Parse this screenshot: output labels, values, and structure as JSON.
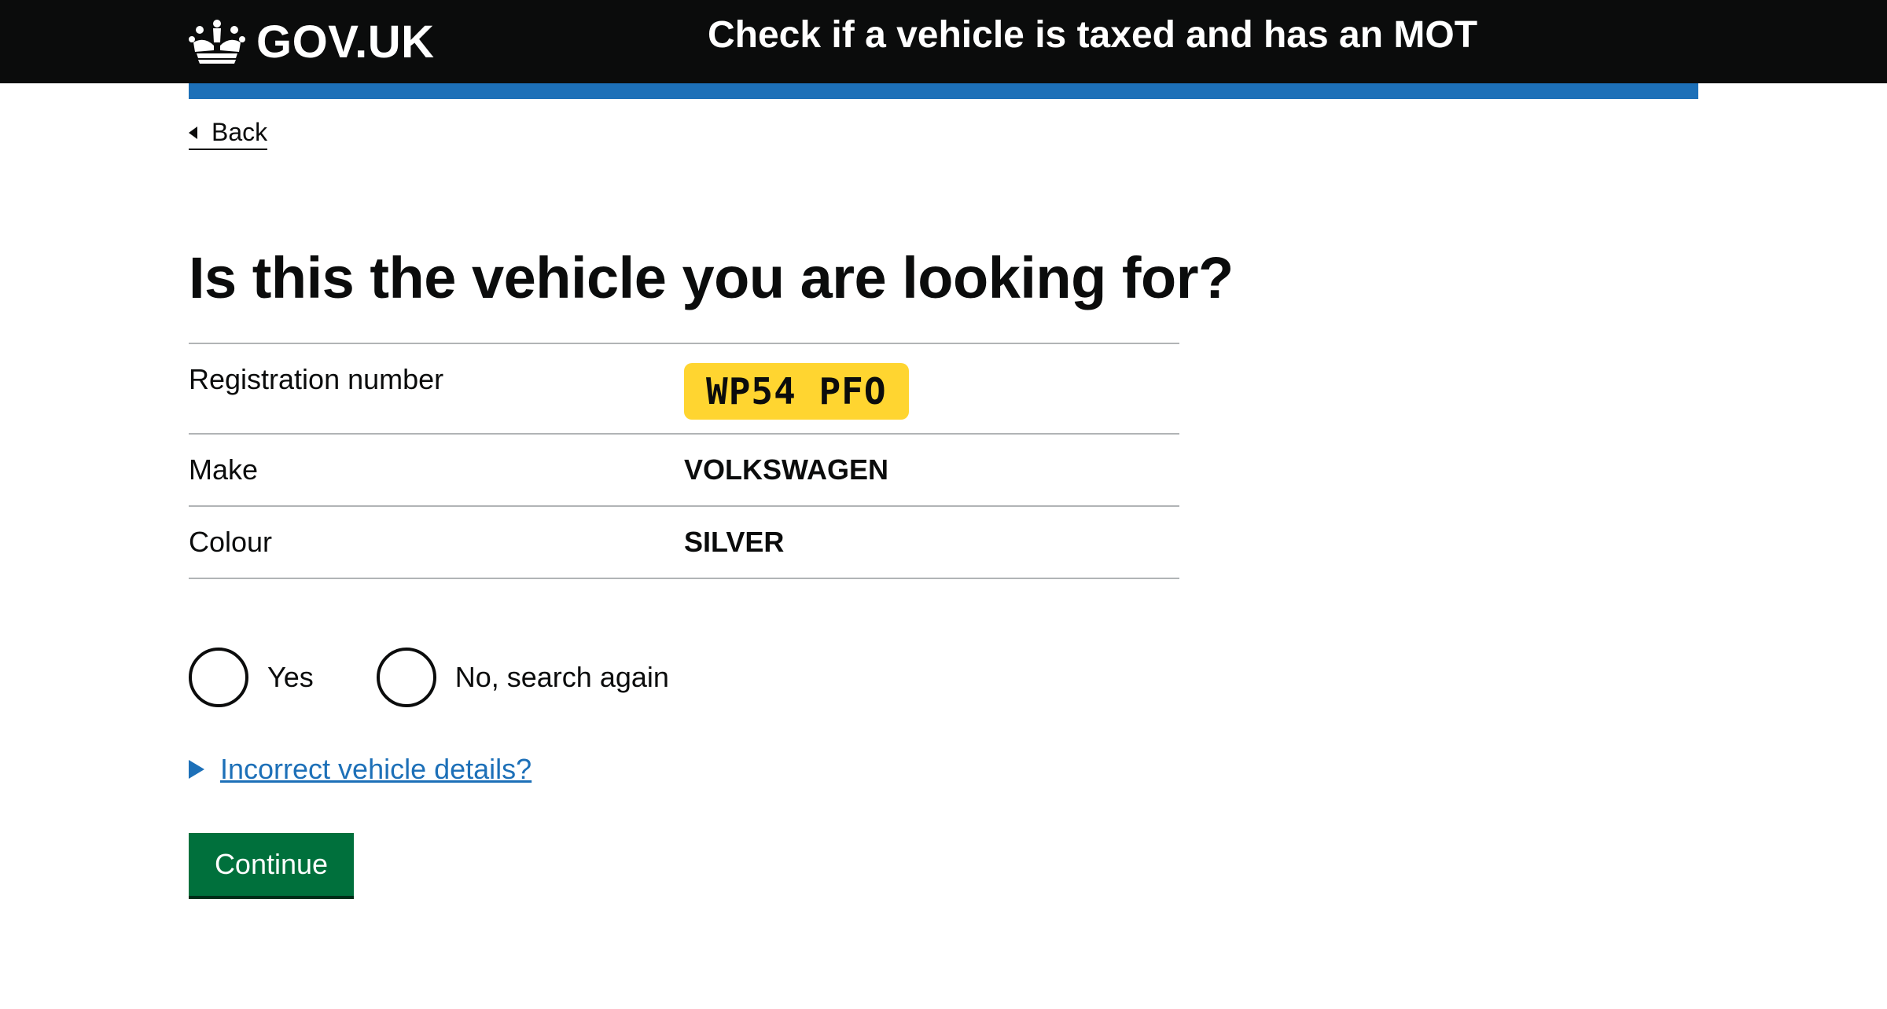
{
  "header": {
    "logo_text": "GOV.UK",
    "service_name": "Check if a vehicle is taxed and has an MOT",
    "logo_icon": "crown-icon"
  },
  "nav": {
    "back_label": "Back"
  },
  "main": {
    "title": "Is this the vehicle you are looking for?",
    "summary": [
      {
        "key": "Registration number",
        "value": "WP54 PFO"
      },
      {
        "key": "Make",
        "value": "VOLKSWAGEN"
      },
      {
        "key": "Colour",
        "value": "SILVER"
      }
    ],
    "radios": [
      {
        "label": "Yes"
      },
      {
        "label": "No, search again"
      }
    ],
    "details_label": "Incorrect vehicle details?",
    "continue_label": "Continue"
  },
  "colors": {
    "header_bg": "#0b0c0c",
    "accent_blue": "#1d70b8",
    "button_green": "#00703c",
    "plate_yellow": "#ffd530"
  }
}
